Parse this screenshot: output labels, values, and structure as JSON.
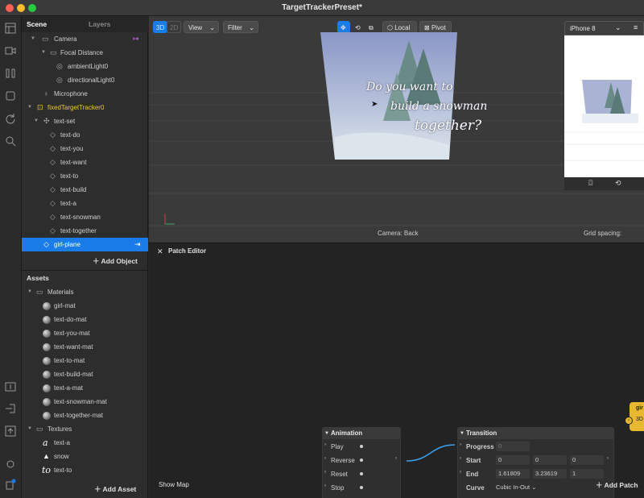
{
  "window": {
    "title": "TargetTrackerPreset*"
  },
  "scene": {
    "tabs": [
      "Scene",
      "Layers"
    ],
    "items": [
      {
        "label": "Camera"
      },
      {
        "label": "Focal Distance"
      },
      {
        "label": "ambientLight0"
      },
      {
        "label": "directionalLight0"
      },
      {
        "label": "Microphone"
      },
      {
        "label": "fixedTargetTracker0"
      },
      {
        "label": "text-set"
      },
      {
        "label": "text-do"
      },
      {
        "label": "text-you"
      },
      {
        "label": "text-want"
      },
      {
        "label": "text-to"
      },
      {
        "label": "text-build"
      },
      {
        "label": "text-a"
      },
      {
        "label": "text-snowman"
      },
      {
        "label": "text-together"
      },
      {
        "label": "girl-plane"
      }
    ],
    "add_object": "Add Object"
  },
  "assets": {
    "title": "Assets",
    "materials_label": "Materials",
    "materials": [
      "girl-mat",
      "text-do-mat",
      "text-you-mat",
      "text-want-mat",
      "text-to-mat",
      "text-build-mat",
      "text-a-mat",
      "text-snowman-mat",
      "text-together-mat"
    ],
    "textures_label": "Textures",
    "textures": [
      "text-a",
      "snow",
      "text-to"
    ],
    "add_asset": "Add Asset"
  },
  "viewport": {
    "mode_3d": "3D",
    "mode_2d": "2D",
    "view_label": "View",
    "filter_label": "Filter",
    "local_label": "Local",
    "pivot_label": "Pivot",
    "device": "iPhone 8",
    "camera_status": "Camera: Back",
    "grid_spacing": "Grid spacing:",
    "card_text": [
      "Do you want to",
      "build a snowman",
      "together?"
    ]
  },
  "patch_editor": {
    "title": "Patch Editor",
    "show_map": "Show Map",
    "add_patch": "Add Patch",
    "animation_node": {
      "title": "Animation",
      "ports": [
        "Play",
        "Reverse",
        "Reset",
        "Stop"
      ]
    },
    "transition_node": {
      "title": "Transition",
      "progress_label": "Progress",
      "progress_value": "0",
      "start_label": "Start",
      "start_values": [
        "0",
        "0",
        "0"
      ],
      "end_label": "End",
      "end_values": [
        "1.61809",
        "3.23619",
        "1"
      ],
      "curve_label": "Curve",
      "curve_value": "Cubic In-Out"
    },
    "partial_node": {
      "title": "gir",
      "sub": "3D"
    }
  },
  "colors": {
    "accent": "#1a7ce8",
    "selection": "#1a7ce8",
    "tracker": "#e8c840",
    "link_blue": "#3aa0f0"
  }
}
